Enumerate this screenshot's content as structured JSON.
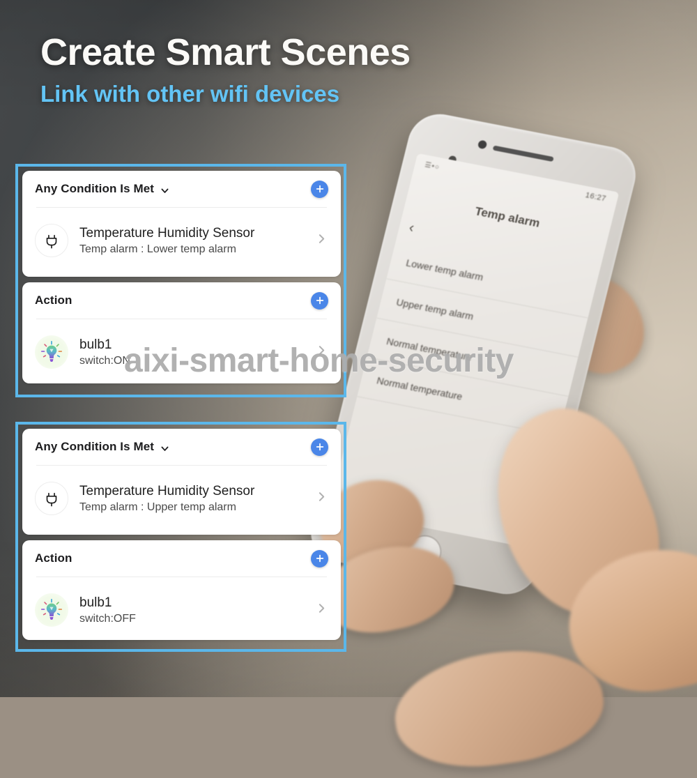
{
  "heading": {
    "title": "Create Smart Scenes",
    "subtitle": "Link with other wifi devices",
    "title_color": "#fbfaf7",
    "subtitle_color": "#63c4f5"
  },
  "watermark": {
    "text": "aixi-smart-home-security"
  },
  "theme": {
    "frame_border_color": "#5bb7ea",
    "plus_button_color": "#4a86e8",
    "panel_background": "#ffffff",
    "divider_color": "#ececec"
  },
  "scenes": [
    {
      "condition": {
        "title": "Any Condition Is Met",
        "dropdown_icon": "chevron-down-icon",
        "add_icon": "plus-icon",
        "row": {
          "icon": "plug-icon",
          "title": "Temperature Humidity Sensor",
          "subtitle": "Temp alarm : Lower temp alarm",
          "chevron": "chevron-right-icon"
        }
      },
      "action": {
        "title": "Action",
        "add_icon": "plus-icon",
        "row": {
          "icon": "light-bulb-icon",
          "title": "bulb1",
          "subtitle": "switch:ON",
          "chevron": "chevron-right-icon"
        }
      }
    },
    {
      "condition": {
        "title": "Any Condition Is Met",
        "dropdown_icon": "chevron-down-icon",
        "add_icon": "plus-icon",
        "row": {
          "icon": "plug-icon",
          "title": "Temperature Humidity Sensor",
          "subtitle": "Temp alarm : Upper temp alarm",
          "chevron": "chevron-right-icon"
        }
      },
      "action": {
        "title": "Action",
        "add_icon": "plus-icon",
        "row": {
          "icon": "light-bulb-icon",
          "title": "bulb1",
          "subtitle": "switch:OFF",
          "chevron": "chevron-right-icon"
        }
      }
    }
  ],
  "phone": {
    "status_bar": {
      "time": "16:27",
      "signal": "signal-wifi-icons"
    },
    "screen_title": "Temp alarm",
    "back_icon": "back-chevron-icon",
    "list": [
      "Lower temp alarm",
      "Upper temp alarm",
      "Normal temperature",
      "Normal temperature"
    ]
  }
}
